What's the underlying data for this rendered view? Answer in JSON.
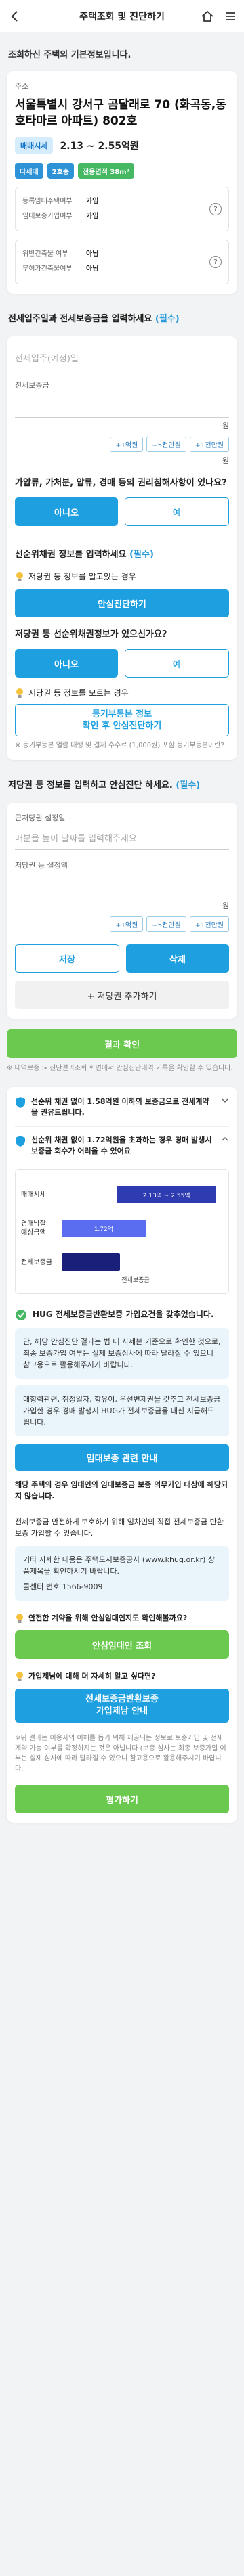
{
  "header": {
    "title": "주택조회 및 진단하기"
  },
  "intro": "조회하신 주택의 기본정보입니다.",
  "address": {
    "label": "주소",
    "value": "서울특별시 강서구 곰달래로 70 (화곡동,동호타마르 아파트) 802호"
  },
  "price": {
    "badge": "매매시세",
    "value": "2.13 ~ 2.55억원"
  },
  "tags": [
    {
      "label": "다세대",
      "color": "#2d93d6"
    },
    {
      "label": "2호층",
      "color": "#2d93d6"
    },
    {
      "label": "전용면적 38m²",
      "color": "#46b864"
    }
  ],
  "register_info": [
    {
      "k": "등록임대주택여부",
      "v": "가입"
    },
    {
      "k": "임대보증가입여부",
      "v": "가입"
    },
    {
      "k": "위반건축물 여부",
      "v": "아님"
    },
    {
      "k": "무허가건축물여부",
      "v": "아님"
    }
  ],
  "deposit": {
    "title": "전세입주일과 전세보증금을 입력하세요",
    "req": "(필수)",
    "date_label": "전세입주(예정)일",
    "amount_label": "전세보증금",
    "unit": "원",
    "pills": [
      "+1억원",
      "+5천만원",
      "+1천만원"
    ],
    "q1": "가압류, 가처분, 압류, 경매 등의 권리침해사항이 있나요?",
    "no": "아니오",
    "yes": "예",
    "senior_title": "선순위채권 정보를 입력하세요",
    "senior_req": "(필수)",
    "senior_q": "저당권 등 정보를 알고있는 경우",
    "senior_btn": "안심진단하기",
    "senior_q2": "저당권 등 선순위채권정보가 있으신가요?",
    "no2": "아니오",
    "yes2": "예",
    "unknown_q": "저당권 등 정보를 모르는 경우",
    "unknown_btn": "등기부등본 정보\n확인 후 안심진단하기",
    "unknown_note": "※ 등기부등본 열람 대행 및 결제 수수료 (1,000원) 포함 등기부등본이란?"
  },
  "manual": {
    "title": "저당권 등 정보를 입력하고 안심진단 하세요.",
    "req": "(필수)",
    "lender_label": "근저당권 설정일",
    "lender_placeholder": "배분을 높이 날짜를 입력해주세요",
    "amount_label": "저당권 등 설정액",
    "unit": "원",
    "pills": [
      "+1억원",
      "+5천만원",
      "+1천만원"
    ],
    "save": "저장",
    "delete": "삭제",
    "add": "+ 저당권 추가하기"
  },
  "result_btn": "결과 확인",
  "result_note": "※ 내역보증 > 진단결과조회 화면에서 안심진단내역 기록을 확인할 수 있습니다.",
  "result": {
    "item1": "선순위 채권 없이 1.58억원 이하의 보증금으로 전세계약을 권유드립니다.",
    "item2": "선순위 채권 없이 1.72억원을 초과하는 경우 경매 발생시 보증금 회수가 어려울 수 있어요",
    "bar_labels": [
      "매매시세",
      "경매낙찰\n예상금액",
      "전세보증금"
    ],
    "bar_values": [
      "2.13억 ~ 2.55억",
      "1.72억",
      ""
    ],
    "bar_note": "전세보증금",
    "hug": "HUG 전세보증금반환보증 가입요건을 갖추었습니다.",
    "warn": "단, 해당 안심진단 결과는 법 내 사세본 기준으로 확인한 것으로, 최종 보증가입 여부는 실제 보증심사에 따라 달라질 수 있으니 참고용으로 활용해주시기 바랍니다.",
    "warn2": "대항력관련, 취정일자, 항유이, 우선변제권을 갖추고 전세보증금 가입한 경우 경매 발생시 HUG가 전세보증금을 대신 지급해드립니다.",
    "guide_title": "임대보증 관련 안내",
    "guide1": "해당 주택의 경우 임대인의 임대보증금 보증 의무가입 대상에 해당되지 않습니다.",
    "guide2": "전세보증금 안전하게 보호하기 위해 임차인의 직접 전세보증금 반환보증 가입할 수 있습니다.",
    "guide3": "기타 자세한 내용은 주택도시보증공사 (www.khug.or.kr) 상품제목을 확인하시기 바랍니다.",
    "guide4": "콜센터 번호 1566-9009",
    "safe_q": "안전한 계약을 위해 안심임대인지도 확인해볼까요?",
    "safe_btn": "안심임대인 조회",
    "hug_q": "가입제남에 대해 더 자세히 알고 싶다면?",
    "hug_btn": "전세보증금반환보증\n가입제남 안내",
    "footer_note": "※위 결과는 이용자의 이해를 돕기 위해 제공되는 정보로 보증가입 및 전세계약 가능 여부를 확정하지는 것은 아닙니다 (보증 심사는 최종 보증가입 여부는 실제 심사에 따라 달라질 수 있으니 참고용으로 활용해주시기 바랍니다.",
    "eval_btn": "평가하기"
  }
}
